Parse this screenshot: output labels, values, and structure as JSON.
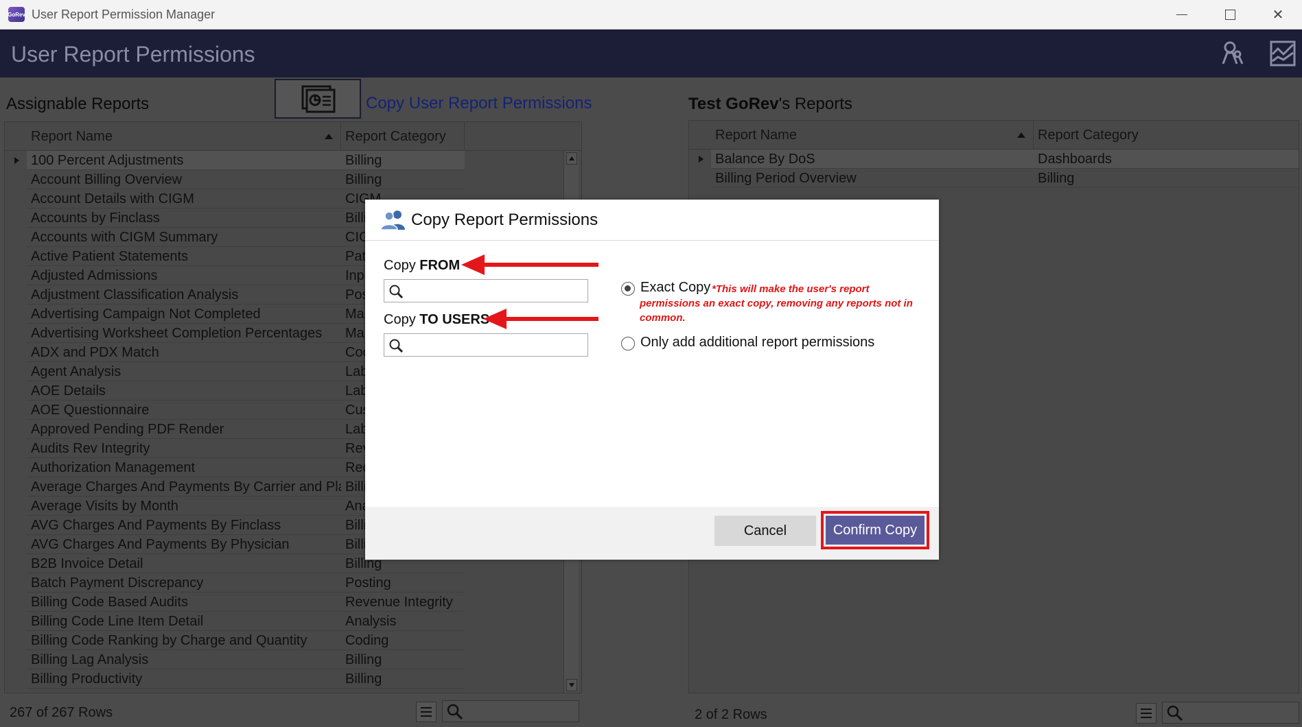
{
  "window": {
    "title": "User Report Permission Manager",
    "app_icon_text": "GoRev"
  },
  "header": {
    "page_title": "User Report Permissions"
  },
  "left": {
    "section_title": "Assignable Reports",
    "copy_link": "Copy User Report Permissions",
    "columns": [
      "Report Name",
      "Report Category"
    ],
    "rows": [
      [
        "100 Percent Adjustments",
        "Billing"
      ],
      [
        "Account Billing Overview",
        "Billing"
      ],
      [
        "Account Details with CIGM",
        "CIGM"
      ],
      [
        "Accounts by Finclass",
        "Billi"
      ],
      [
        "Accounts with CIGM Summary",
        "CIG"
      ],
      [
        "Active Patient Statements",
        "Pati"
      ],
      [
        "Adjusted Admissions",
        "Inpa"
      ],
      [
        "Adjustment Classification Analysis",
        "Pos"
      ],
      [
        "Advertising Campaign Not Completed",
        "Mar"
      ],
      [
        "Advertising Worksheet Completion Percentages",
        "Mar"
      ],
      [
        "ADX and PDX Match",
        "Coc"
      ],
      [
        "Agent Analysis",
        "Lab"
      ],
      [
        "AOE Details",
        "Lab"
      ],
      [
        "AOE Questionnaire",
        "Cus"
      ],
      [
        "Approved Pending PDF Render",
        "Lab"
      ],
      [
        "Audits Rev Integrity",
        "Rev"
      ],
      [
        "Authorization Management",
        "Req"
      ],
      [
        "Average Charges And Payments By Carrier and Plan",
        "Billi"
      ],
      [
        "Average Visits by Month",
        "Ana"
      ],
      [
        "AVG Charges And Payments By Finclass",
        "Billi"
      ],
      [
        "AVG Charges And Payments By Physician",
        "Billi"
      ],
      [
        "B2B Invoice Detail",
        "Billing"
      ],
      [
        "Batch Payment Discrepancy",
        "Posting"
      ],
      [
        "Billing Code Based Audits",
        "Revenue Integrity"
      ],
      [
        "Billing Code Line Item Detail",
        "Analysis"
      ],
      [
        "Billing Code Ranking by Charge and Quantity",
        "Coding"
      ],
      [
        "Billing Lag Analysis",
        "Billing"
      ],
      [
        "Billing Productivity",
        "Billing"
      ]
    ],
    "footer_count": "267 of 267 Rows"
  },
  "right": {
    "user_name": "Test GoRev",
    "section_suffix": "'s Reports",
    "columns": [
      "Report Name",
      "Report Category"
    ],
    "rows": [
      [
        "Balance By DoS",
        "Dashboards"
      ],
      [
        "Billing Period Overview",
        "Billing"
      ]
    ],
    "footer_count": "2 of 2 Rows"
  },
  "modal": {
    "title": "Copy Report Permissions",
    "from_label_prefix": "Copy ",
    "from_label_bold": "FROM",
    "to_label_prefix": "Copy ",
    "to_label_bold": "TO USERS",
    "from_value": "",
    "to_value": "",
    "option_exact": "Exact Copy",
    "option_exact_note_1": "*This will make the user's report",
    "option_exact_note_2": "permissions an exact copy, removing any reports not in",
    "option_exact_note_3": "common.",
    "option_add": "Only add additional report permissions",
    "selected_option": "exact",
    "cancel_label": "Cancel",
    "confirm_label": "Confirm Copy"
  },
  "colors": {
    "header_bg": "#1c1d36",
    "confirm_bg": "#5a5a9a",
    "highlight_red": "#e4161b",
    "link": "#152275"
  }
}
